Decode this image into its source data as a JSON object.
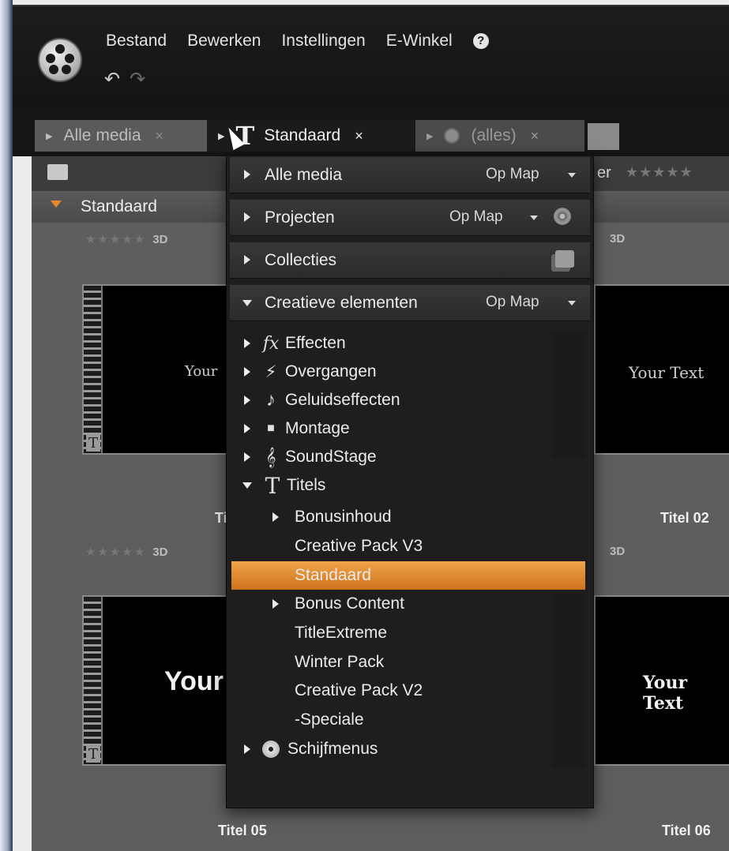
{
  "menubar": {
    "items": [
      "Bestand",
      "Bewerken",
      "Instellingen",
      "E-Winkel"
    ],
    "help_icon": "help-icon",
    "undo_icon": "undo-icon",
    "redo_icon": "redo-icon"
  },
  "tabs": [
    {
      "label": "Alle media",
      "close": "×",
      "active": false
    },
    {
      "label": "Standaard",
      "close": "×",
      "active": true,
      "icon": "title-icon"
    },
    {
      "label": "(alles)",
      "close": "×",
      "active": false,
      "icon": "disc-icon"
    }
  ],
  "library": {
    "filter_label": "er",
    "filter_stars": "★★★★★"
  },
  "collection": {
    "name": "Standaard"
  },
  "grid": {
    "rating_stars": "★★★★★",
    "badge_3d": "3D",
    "items": [
      {
        "title": "Ti",
        "preview": "Your"
      },
      {
        "title": "Titel 02",
        "preview": "Your Text"
      },
      {
        "title": "Titel 05",
        "preview": "Your"
      },
      {
        "title": "Titel 06",
        "preview": "Your Text"
      }
    ]
  },
  "dropdown": {
    "sections": [
      {
        "label": "Alle media",
        "opmap": "Op Map"
      },
      {
        "label": "Projecten",
        "opmap": "Op Map"
      },
      {
        "label": "Collecties"
      },
      {
        "label": "Creatieve elementen",
        "opmap": "Op Map"
      }
    ],
    "tree": [
      {
        "label": "Effecten",
        "icon": "fx-icon"
      },
      {
        "label": "Overgangen",
        "icon": "lightning-icon"
      },
      {
        "label": "Geluidseffecten",
        "icon": "music-note-icon"
      },
      {
        "label": "Montage",
        "icon": "montage-icon"
      },
      {
        "label": "SoundStage",
        "icon": "treble-clef-icon"
      },
      {
        "label": "Titels",
        "icon": "title-icon"
      },
      {
        "label": "Bonusinhoud"
      },
      {
        "label": "Creative Pack V3"
      },
      {
        "label": "Standaard"
      },
      {
        "label": "Bonus Content"
      },
      {
        "label": "TitleExtreme"
      },
      {
        "label": "Winter Pack"
      },
      {
        "label": "Creative Pack V2"
      },
      {
        "label": "-Speciale"
      },
      {
        "label": "Schijfmenus",
        "icon": "disc-icon"
      }
    ]
  },
  "colors": {
    "accent": "#e9882a",
    "menu_bg": "#1e1e1f"
  }
}
